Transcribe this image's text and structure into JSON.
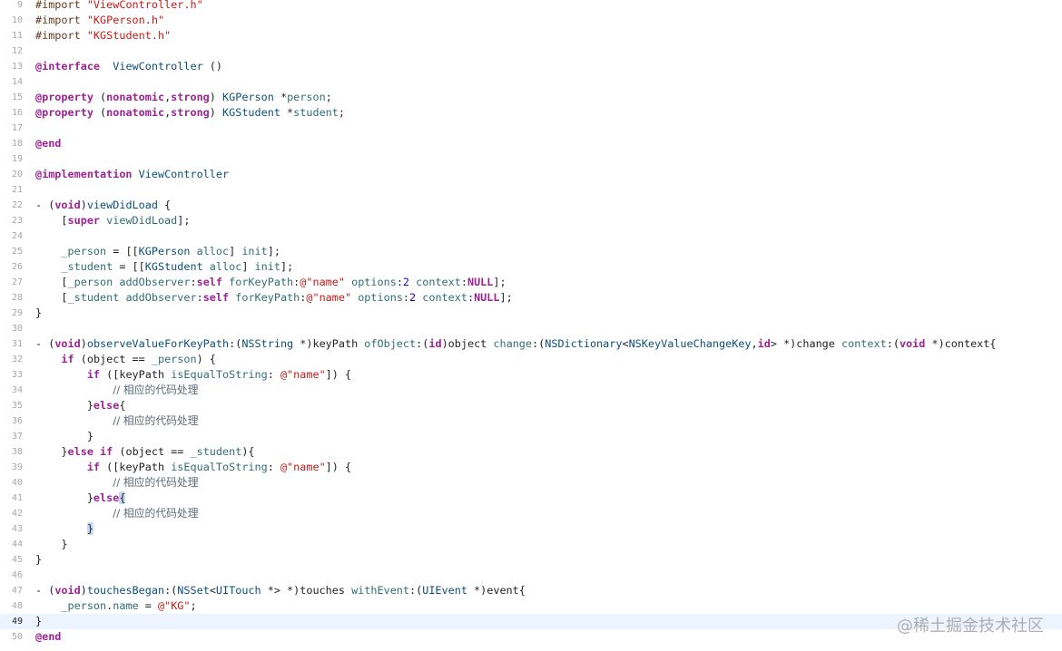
{
  "editor": {
    "current_line": "49",
    "lines": [
      {
        "n": "9",
        "t": [
          [
            "pp",
            "#import "
          ],
          [
            "str",
            "\"ViewController.h\""
          ]
        ]
      },
      {
        "n": "10",
        "t": [
          [
            "pp",
            "#import "
          ],
          [
            "str",
            "\"KGPerson.h\""
          ]
        ]
      },
      {
        "n": "11",
        "t": [
          [
            "pp",
            "#import "
          ],
          [
            "str",
            "\"KGStudent.h\""
          ]
        ]
      },
      {
        "n": "12",
        "t": []
      },
      {
        "n": "13",
        "t": [
          [
            "kw",
            "@interface"
          ],
          [
            "",
            "  "
          ],
          [
            "cls",
            "ViewController"
          ],
          [
            "",
            " ()"
          ]
        ]
      },
      {
        "n": "14",
        "t": []
      },
      {
        "n": "15",
        "t": [
          [
            "kw",
            "@property"
          ],
          [
            "",
            " ("
          ],
          [
            "kw",
            "nonatomic"
          ],
          [
            "",
            ","
          ],
          [
            "kw",
            "strong"
          ],
          [
            "",
            ") "
          ],
          [
            "cls",
            "KGPerson"
          ],
          [
            "",
            " *"
          ],
          [
            "prop",
            "person"
          ],
          [
            "",
            ";"
          ]
        ]
      },
      {
        "n": "16",
        "t": [
          [
            "kw",
            "@property"
          ],
          [
            "",
            " ("
          ],
          [
            "kw",
            "nonatomic"
          ],
          [
            "",
            ","
          ],
          [
            "kw",
            "strong"
          ],
          [
            "",
            ") "
          ],
          [
            "cls",
            "KGStudent"
          ],
          [
            "",
            " *"
          ],
          [
            "prop",
            "student"
          ],
          [
            "",
            ";"
          ]
        ]
      },
      {
        "n": "17",
        "t": []
      },
      {
        "n": "18",
        "t": [
          [
            "kw",
            "@end"
          ]
        ]
      },
      {
        "n": "19",
        "t": []
      },
      {
        "n": "20",
        "t": [
          [
            "kw",
            "@implementation"
          ],
          [
            "",
            " "
          ],
          [
            "cls",
            "ViewController"
          ]
        ]
      },
      {
        "n": "21",
        "t": []
      },
      {
        "n": "22",
        "t": [
          [
            "",
            "- ("
          ],
          [
            "kw",
            "void"
          ],
          [
            "",
            ")"
          ],
          [
            "cls",
            "viewDidLoad"
          ],
          [
            "",
            " {"
          ]
        ]
      },
      {
        "n": "23",
        "t": [
          [
            "",
            "    ["
          ],
          [
            "kw",
            "super"
          ],
          [
            "",
            " "
          ],
          [
            "meth",
            "viewDidLoad"
          ],
          [
            "",
            "];"
          ]
        ]
      },
      {
        "n": "24",
        "t": []
      },
      {
        "n": "25",
        "t": [
          [
            "",
            "    "
          ],
          [
            "prop",
            "_person"
          ],
          [
            "",
            " = [["
          ],
          [
            "cls",
            "KGPerson"
          ],
          [
            "",
            " "
          ],
          [
            "meth",
            "alloc"
          ],
          [
            "",
            "] "
          ],
          [
            "meth",
            "init"
          ],
          [
            "",
            "];"
          ]
        ]
      },
      {
        "n": "26",
        "t": [
          [
            "",
            "    "
          ],
          [
            "prop",
            "_student"
          ],
          [
            "",
            " = [["
          ],
          [
            "cls",
            "KGStudent"
          ],
          [
            "",
            " "
          ],
          [
            "meth",
            "alloc"
          ],
          [
            "",
            "] "
          ],
          [
            "meth",
            "init"
          ],
          [
            "",
            "];"
          ]
        ]
      },
      {
        "n": "27",
        "t": [
          [
            "",
            "    ["
          ],
          [
            "prop",
            "_person"
          ],
          [
            "",
            " "
          ],
          [
            "meth",
            "addObserver"
          ],
          [
            "",
            ":"
          ],
          [
            "kw",
            "self"
          ],
          [
            "",
            " "
          ],
          [
            "meth",
            "forKeyPath"
          ],
          [
            "",
            ":"
          ],
          [
            "str",
            "@\"name\""
          ],
          [
            "",
            " "
          ],
          [
            "meth",
            "options"
          ],
          [
            "",
            ":"
          ],
          [
            "num",
            "2"
          ],
          [
            "",
            " "
          ],
          [
            "meth",
            "context"
          ],
          [
            "",
            ":"
          ],
          [
            "kw",
            "NULL"
          ],
          [
            "",
            "];"
          ]
        ]
      },
      {
        "n": "28",
        "t": [
          [
            "",
            "    ["
          ],
          [
            "prop",
            "_student"
          ],
          [
            "",
            " "
          ],
          [
            "meth",
            "addObserver"
          ],
          [
            "",
            ":"
          ],
          [
            "kw",
            "self"
          ],
          [
            "",
            " "
          ],
          [
            "meth",
            "forKeyPath"
          ],
          [
            "",
            ":"
          ],
          [
            "str",
            "@\"name\""
          ],
          [
            "",
            " "
          ],
          [
            "meth",
            "options"
          ],
          [
            "",
            ":"
          ],
          [
            "num",
            "2"
          ],
          [
            "",
            " "
          ],
          [
            "meth",
            "context"
          ],
          [
            "",
            ":"
          ],
          [
            "kw",
            "NULL"
          ],
          [
            "",
            "];"
          ]
        ]
      },
      {
        "n": "29",
        "t": [
          [
            "",
            "}"
          ]
        ]
      },
      {
        "n": "30",
        "t": []
      },
      {
        "n": "31",
        "t": [
          [
            "",
            "- ("
          ],
          [
            "kw",
            "void"
          ],
          [
            "",
            ")"
          ],
          [
            "cls",
            "observeValueForKeyPath"
          ],
          [
            "",
            ":("
          ],
          [
            "cls",
            "NSString"
          ],
          [
            "",
            " *)keyPath "
          ],
          [
            "meth",
            "ofObject"
          ],
          [
            "",
            ":("
          ],
          [
            "kw",
            "id"
          ],
          [
            "",
            ")object "
          ],
          [
            "meth",
            "change"
          ],
          [
            "",
            ":("
          ],
          [
            "cls",
            "NSDictionary"
          ],
          [
            "",
            "<"
          ],
          [
            "cls",
            "NSKeyValueChangeKey"
          ],
          [
            "",
            ","
          ],
          [
            "kw",
            "id"
          ],
          [
            "",
            "> *)change "
          ],
          [
            "meth",
            "context"
          ],
          [
            "",
            ":("
          ],
          [
            "kw",
            "void"
          ],
          [
            "",
            " *)context{"
          ]
        ]
      },
      {
        "n": "32",
        "t": [
          [
            "",
            "    "
          ],
          [
            "kw",
            "if"
          ],
          [
            "",
            " (object == "
          ],
          [
            "prop",
            "_person"
          ],
          [
            "",
            ") {"
          ]
        ]
      },
      {
        "n": "33",
        "t": [
          [
            "",
            "        "
          ],
          [
            "kw",
            "if"
          ],
          [
            "",
            " ([keyPath "
          ],
          [
            "meth",
            "isEqualToString"
          ],
          [
            "",
            ": "
          ],
          [
            "str",
            "@\"name\""
          ],
          [
            "",
            "]) {"
          ]
        ]
      },
      {
        "n": "34",
        "t": [
          [
            "",
            "            "
          ],
          [
            "cmt",
            "// 相应的代码处理"
          ]
        ]
      },
      {
        "n": "35",
        "t": [
          [
            "",
            "        }"
          ],
          [
            "kw",
            "else"
          ],
          [
            "",
            "{"
          ]
        ]
      },
      {
        "n": "36",
        "t": [
          [
            "",
            "            "
          ],
          [
            "cmt",
            "// 相应的代码处理"
          ]
        ]
      },
      {
        "n": "37",
        "t": [
          [
            "",
            "        }"
          ]
        ]
      },
      {
        "n": "38",
        "t": [
          [
            "",
            "    }"
          ],
          [
            "kw",
            "else"
          ],
          [
            "",
            " "
          ],
          [
            "kw",
            "if"
          ],
          [
            "",
            " (object == "
          ],
          [
            "prop",
            "_student"
          ],
          [
            "",
            "){"
          ]
        ]
      },
      {
        "n": "39",
        "t": [
          [
            "",
            "        "
          ],
          [
            "kw",
            "if"
          ],
          [
            "",
            " ([keyPath "
          ],
          [
            "meth",
            "isEqualToString"
          ],
          [
            "",
            ": "
          ],
          [
            "str",
            "@\"name\""
          ],
          [
            "",
            "]) {"
          ]
        ]
      },
      {
        "n": "40",
        "t": [
          [
            "",
            "            "
          ],
          [
            "cmt",
            "// 相应的代码处理"
          ]
        ]
      },
      {
        "n": "41",
        "t": [
          [
            "",
            "        }"
          ],
          [
            "kw",
            "else"
          ],
          [
            "brk",
            "{"
          ]
        ]
      },
      {
        "n": "42",
        "t": [
          [
            "",
            "            "
          ],
          [
            "cmt",
            "// 相应的代码处理"
          ]
        ]
      },
      {
        "n": "43",
        "t": [
          [
            "",
            "        "
          ],
          [
            "brk",
            "}"
          ]
        ]
      },
      {
        "n": "44",
        "t": [
          [
            "",
            "    }"
          ]
        ]
      },
      {
        "n": "45",
        "t": [
          [
            "",
            "}"
          ]
        ]
      },
      {
        "n": "46",
        "t": []
      },
      {
        "n": "47",
        "t": [
          [
            "",
            "- ("
          ],
          [
            "kw",
            "void"
          ],
          [
            "",
            ")"
          ],
          [
            "cls",
            "touchesBegan"
          ],
          [
            "",
            ":("
          ],
          [
            "cls",
            "NSSet"
          ],
          [
            "",
            "<"
          ],
          [
            "cls",
            "UITouch"
          ],
          [
            "",
            " *> *)touches "
          ],
          [
            "meth",
            "withEvent"
          ],
          [
            "",
            ":("
          ],
          [
            "cls",
            "UIEvent"
          ],
          [
            "",
            " *)event{"
          ]
        ]
      },
      {
        "n": "48",
        "t": [
          [
            "",
            "    "
          ],
          [
            "prop",
            "_person"
          ],
          [
            "",
            "."
          ],
          [
            "prop",
            "name"
          ],
          [
            "",
            " = "
          ],
          [
            "str",
            "@\"KG\""
          ],
          [
            "",
            ";"
          ]
        ]
      },
      {
        "n": "49",
        "t": [
          [
            "",
            "}"
          ]
        ]
      },
      {
        "n": "50",
        "t": [
          [
            "kw",
            "@end"
          ]
        ]
      }
    ]
  },
  "watermark": {
    "text": "@稀土掘金技术社区"
  }
}
